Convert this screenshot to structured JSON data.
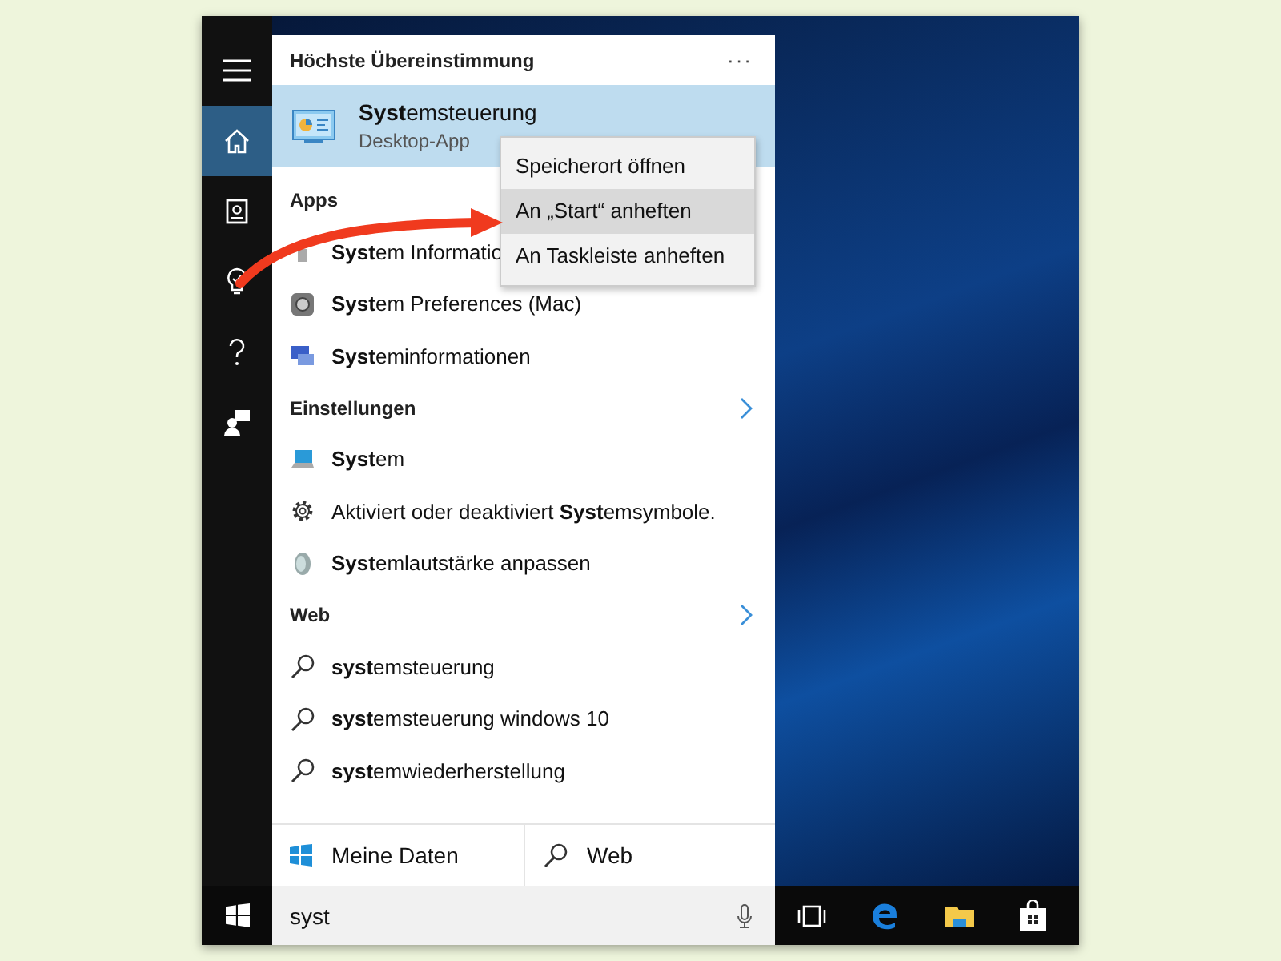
{
  "nav": [
    {
      "kind": "menu",
      "selected": false
    },
    {
      "kind": "home",
      "selected": true
    },
    {
      "kind": "notebook",
      "selected": false
    },
    {
      "kind": "bulb",
      "selected": false
    },
    {
      "kind": "help",
      "selected": false
    },
    {
      "kind": "feedback",
      "selected": false
    }
  ],
  "best_match": {
    "heading": "Höchste Übereinstimmung",
    "more": "···",
    "title": "**Syst**emsteuerung",
    "subtitle": "Desktop-App",
    "selected": true
  },
  "sections": [
    {
      "heading": "Apps",
      "items": [
        {
          "kind": "info",
          "text": "**Syst**em Informatio"
        },
        {
          "kind": "mac",
          "text": "**Syst**em Preferences (Mac)"
        },
        {
          "kind": "sysinfo",
          "text": "**Syst**eminformationen"
        }
      ]
    },
    {
      "heading": "Einstellungen",
      "chevron": true,
      "items": [
        {
          "kind": "monitor",
          "text": "**Syst**em"
        },
        {
          "kind": "gear",
          "text": "Aktiviert oder deaktiviert **Syst**emsymbole."
        },
        {
          "kind": "speaker",
          "text": "**Syst**emlautstärke anpassen"
        }
      ]
    },
    {
      "heading": "Web",
      "chevron": true,
      "items": [
        {
          "kind": "search",
          "text": "**syst**emsteuerung"
        },
        {
          "kind": "search",
          "text": "**syst**emsteuerung windows 10"
        },
        {
          "kind": "search",
          "text": "**syst**emwiederherstellung"
        }
      ]
    }
  ],
  "context_menu": [
    {
      "label": "Speicherort öffnen",
      "selected": false
    },
    {
      "label": "An „Start“ anheften",
      "selected": true
    },
    {
      "label": "An Taskleiste anheften",
      "selected": false
    }
  ],
  "filters": [
    {
      "kind": "windows",
      "label": "Meine Daten"
    },
    {
      "kind": "search",
      "label": "Web"
    }
  ],
  "search": {
    "value": "syst"
  },
  "taskbar": [
    {
      "kind": "taskview"
    },
    {
      "kind": "edge"
    },
    {
      "kind": "folder"
    },
    {
      "kind": "store"
    }
  ]
}
